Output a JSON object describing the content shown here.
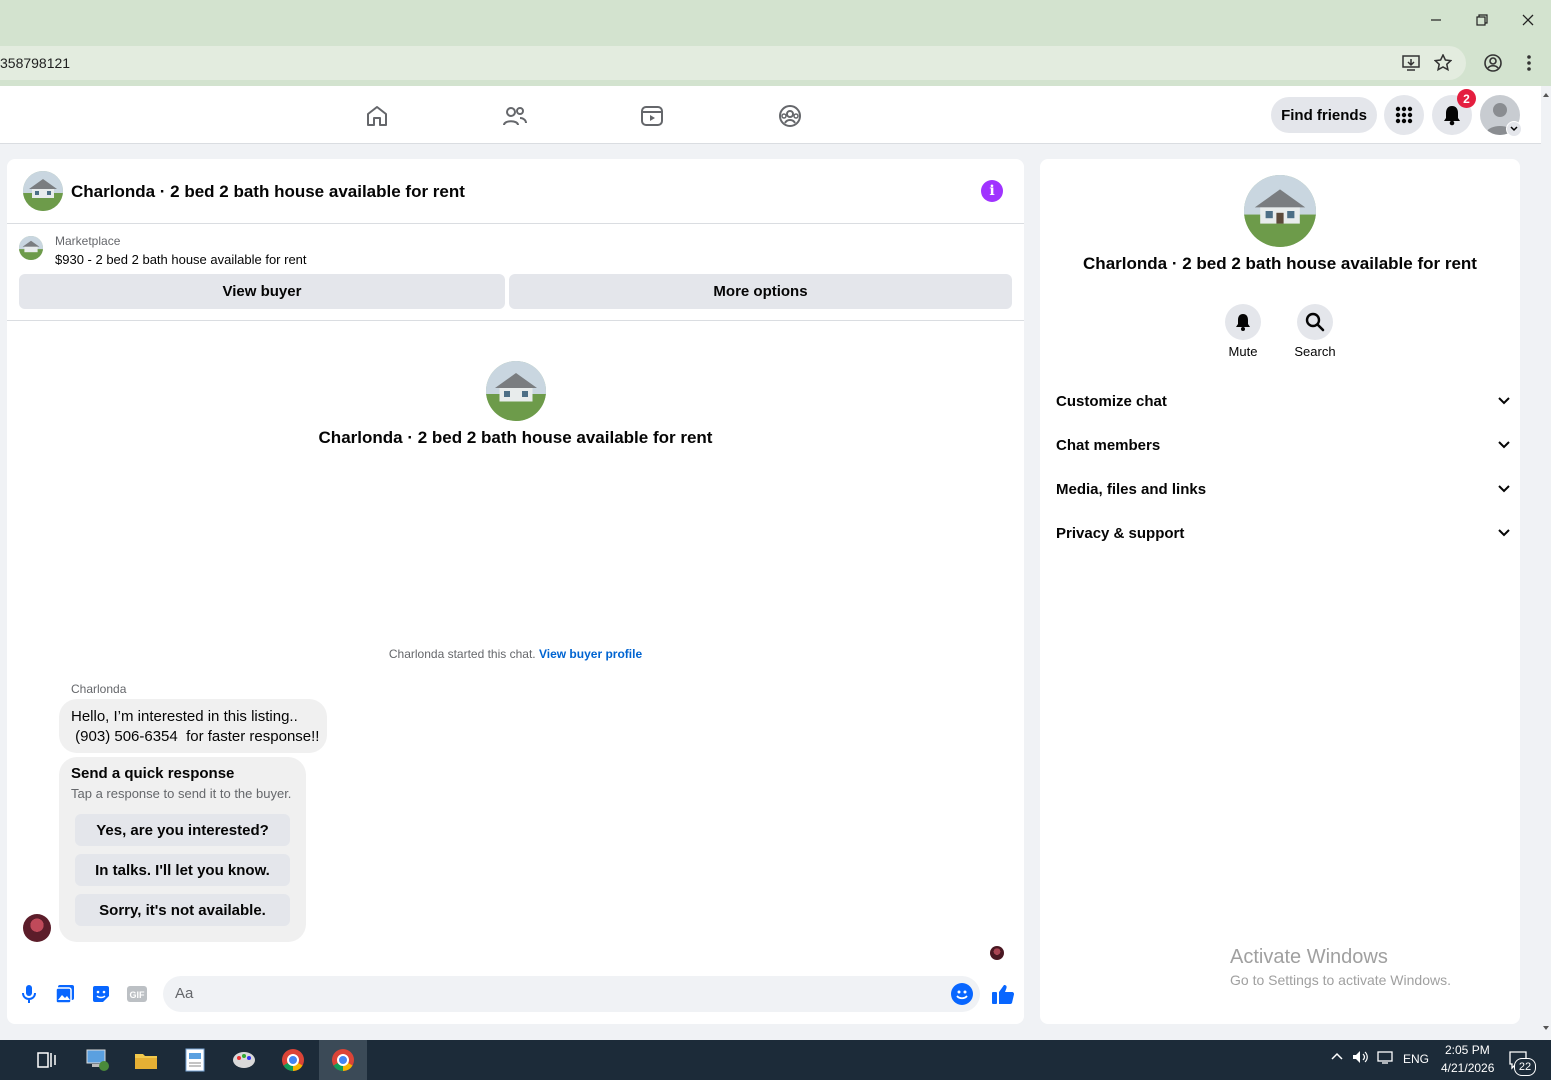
{
  "browser": {
    "url": "358798121",
    "icons": [
      "minimize-icon",
      "restore-icon",
      "close-icon",
      "install-app-icon",
      "bookmark-star-icon",
      "profile-icon",
      "menu-dots-icon"
    ]
  },
  "topnav": {
    "icons": [
      "home-icon",
      "friends-icon",
      "video-icon",
      "groups-icon"
    ],
    "find_friends": "Find friends",
    "notification_count": "2"
  },
  "chat": {
    "title": "Charlonda · 2 bed 2 bath house available for rent",
    "marketplace_label": "Marketplace",
    "listing": "$930 - 2 bed 2 bath house available for rent",
    "view_buyer": "View buyer",
    "more_options": "More options",
    "center_name": "Charlonda · 2 bed 2 bath house available for rent",
    "started_text": "Charlonda started this chat.",
    "view_buyer_profile": "View buyer profile",
    "sender": "Charlonda",
    "message_line1": "Hello, I’m interested in this listing..",
    "message_line2": " (903) 506-6354  for faster response!!",
    "quick_title": "Send a quick response",
    "quick_sub": "Tap a response to send it to the buyer.",
    "quick_responses": [
      "Yes, are you interested?",
      "In talks. I'll let you know.",
      "Sorry, it's not available."
    ],
    "composer_placeholder": "Aa"
  },
  "details": {
    "name": "Charlonda · 2 bed 2 bath house available for rent",
    "mute": "Mute",
    "search": "Search",
    "sections": [
      "Customize chat",
      "Chat members",
      "Media, files and links",
      "Privacy & support"
    ]
  },
  "watermark": {
    "line1": "Activate Windows",
    "line2": "Go to Settings to activate Windows."
  },
  "taskbar": {
    "lang": "ENG",
    "time": "2:05 PM",
    "date": "4/21/2026",
    "notif_count": "22"
  },
  "colors": {
    "accent": "#0866ff",
    "info": "#a033ff",
    "badge": "#e41e3f",
    "browser_frame": "#d3e3cf"
  }
}
